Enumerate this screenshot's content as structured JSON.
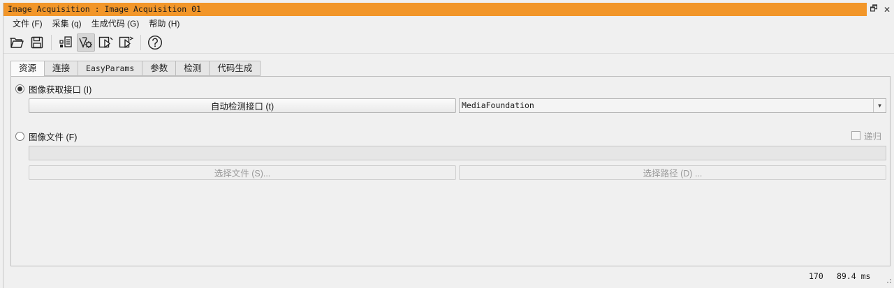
{
  "window": {
    "title": "Image Acquisition : Image Acquisition 01",
    "restore_glyph": "🗗",
    "close_glyph": "✕"
  },
  "menu": [
    {
      "label": "文件 (F)"
    },
    {
      "label": "采集 (q)"
    },
    {
      "label": "生成代码 (G)"
    },
    {
      "label": "帮助 (H)"
    }
  ],
  "toolbar": {
    "icons": [
      "open-folder-icon",
      "save-icon",
      "properties-icon",
      "connect-icon",
      "snap-icon",
      "live-icon",
      "help-icon"
    ]
  },
  "tabs": [
    {
      "label": "资源",
      "active": true
    },
    {
      "label": "连接"
    },
    {
      "label": "EasyParams"
    },
    {
      "label": "参数"
    },
    {
      "label": "检测"
    },
    {
      "label": "代码生成"
    }
  ],
  "source": {
    "interface_radio_label": "图像获取接口 (I)",
    "interface_selected": true,
    "autodetect_button": "自动检测接口 (t)",
    "interface_value": "MediaFoundation",
    "file_radio_label": "图像文件 (F)",
    "recursive_label": "递归",
    "file_path_value": "",
    "select_files_button": "选择文件 (S)...",
    "select_dir_button": "选择路径 (D) ..."
  },
  "status": {
    "count": "170",
    "time": "89.4 ms"
  },
  "colors": {
    "titlebar": "#f29629",
    "background": "#f0f0f0"
  }
}
